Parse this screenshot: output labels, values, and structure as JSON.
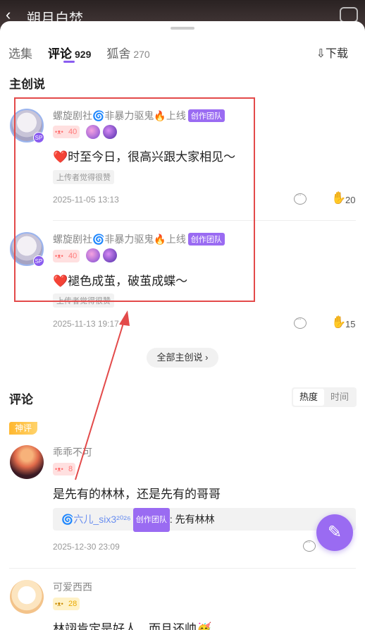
{
  "header": {
    "back_icon": "chevron-left-icon",
    "title": "朔月白焚",
    "share_icon": "share-icon"
  },
  "tabs": [
    {
      "label": "选集",
      "count": ""
    },
    {
      "label": "评论",
      "count": "929"
    },
    {
      "label": "狐舍",
      "count": "270"
    }
  ],
  "download_label": "⇩下载",
  "creator_section": {
    "title": "主创说",
    "posts": [
      {
        "user": "螺旋剧社🌀非暴力驱鬼🔥上线",
        "team_tag": "创作团队",
        "level": "40",
        "text": "❤️时至今日，很高兴跟大家相见～",
        "liked_by_uploader": "上传者觉得很赞",
        "time": "2025-11-05 13:13",
        "likes": "20"
      },
      {
        "user": "螺旋剧社🌀非暴力驱鬼🔥上线",
        "team_tag": "创作团队",
        "level": "40",
        "text": "❤️褪色成茧，破茧成蝶～",
        "liked_by_uploader": "上传者觉得很赞",
        "time": "2025-11-13 19:17",
        "likes": "15"
      }
    ],
    "all_button": "全部主创说 ›"
  },
  "comments_section": {
    "title": "评论",
    "sort": [
      "热度",
      "时间"
    ],
    "god_tag": "神评",
    "comments": [
      {
        "user": "乖乖不可",
        "level": "8",
        "text": "是先有的林林，还是先有的哥哥",
        "reply_user": "🌀六儿_six3²⁰²⁶",
        "reply_tag": "创作团队",
        "reply_text": ": 先有林林",
        "time": "2025-12-30 23:09"
      },
      {
        "user": "可爱西西",
        "level": "28",
        "text": "林翊肯定是好人，而且还帅🥳"
      }
    ]
  },
  "compose_icon": "pencil-icon"
}
